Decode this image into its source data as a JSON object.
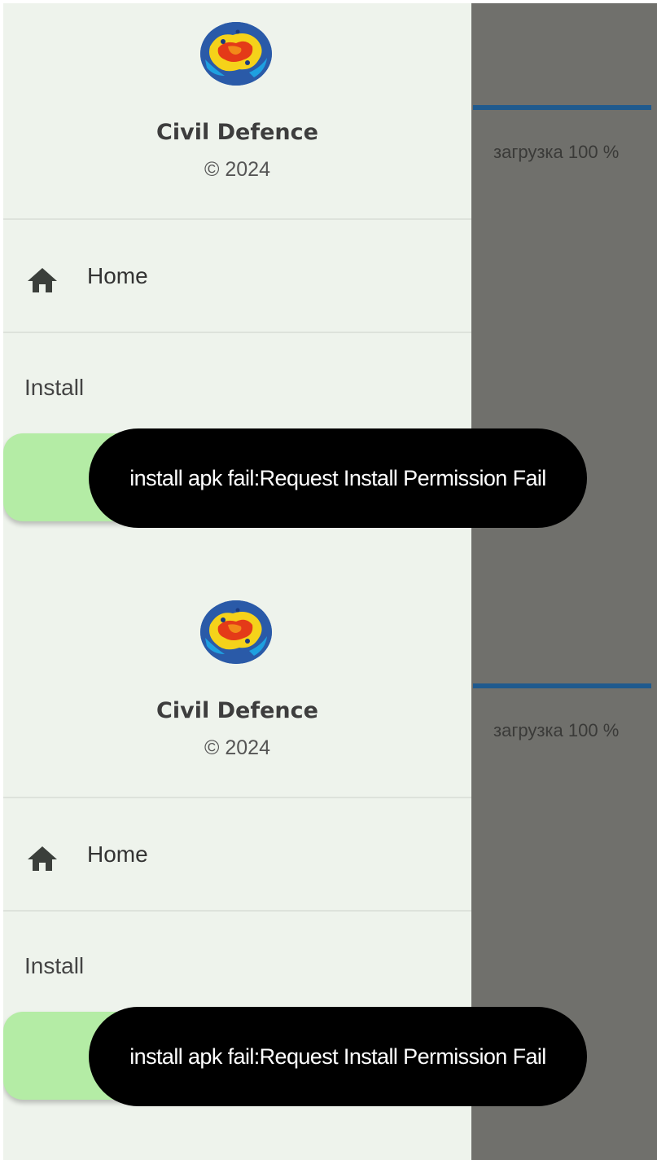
{
  "header": {
    "app_title": "Civil Defence",
    "copyright": "© 2024"
  },
  "nav": {
    "home": {
      "label": "Home",
      "icon": "home-icon"
    }
  },
  "section": {
    "install_label": "Install"
  },
  "progress": {
    "text": "загрузка 100 %",
    "fraction": 1.0
  },
  "toast": {
    "message": "install apk fail:Request Install Permission Fail"
  },
  "colors": {
    "drawer_background": "#eef3ec",
    "scrim": "#70706c",
    "progress": "#1f5a8e",
    "install_button": "#b4eca5",
    "toast_background": "#000000"
  }
}
